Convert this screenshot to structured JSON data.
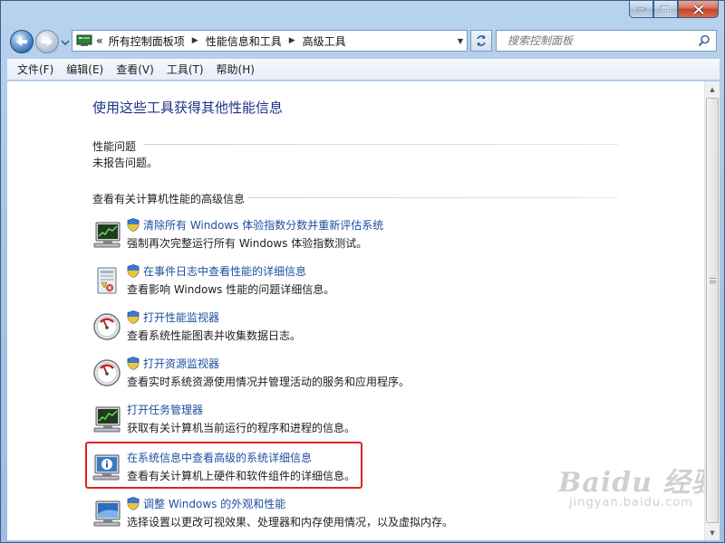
{
  "window": {
    "caption_buttons": [
      "minimize",
      "maximize",
      "close"
    ]
  },
  "address_bar": {
    "chevron": "«",
    "crumbs": [
      "所有控制面板项",
      "性能信息和工具",
      "高级工具"
    ]
  },
  "search": {
    "placeholder": "搜索控制面板"
  },
  "menu": [
    "文件(F)",
    "编辑(E)",
    "查看(V)",
    "工具(T)",
    "帮助(H)"
  ],
  "page": {
    "heading": "使用这些工具获得其他性能信息",
    "performance_issues_title": "性能问题",
    "performance_issues_text": "未报告问题。",
    "advanced_title": "查看有关计算机性能的高级信息"
  },
  "items": [
    {
      "link": "清除所有 Windows 体验指数分数并重新评估系统",
      "desc": "强制再次完整运行所有 Windows 体验指数测试。",
      "icon": "monitor-chart-icon",
      "shield": true
    },
    {
      "link": "在事件日志中查看性能的详细信息",
      "desc": "查看影响 Windows 性能的问题详细信息。",
      "icon": "event-log-icon",
      "shield": true
    },
    {
      "link": "打开性能监视器",
      "desc": "查看系统性能图表并收集数据日志。",
      "icon": "gauge-icon",
      "shield": true
    },
    {
      "link": "打开资源监视器",
      "desc": "查看实时系统资源使用情况并管理活动的服务和应用程序。",
      "icon": "gauge-icon",
      "shield": true
    },
    {
      "link": "打开任务管理器",
      "desc": "获取有关计算机当前运行的程序和进程的信息。",
      "icon": "monitor-chart-icon",
      "shield": false
    },
    {
      "link": "在系统信息中查看高级的系统详细信息",
      "desc": "查看有关计算机上硬件和软件组件的详细信息。",
      "icon": "system-info-icon",
      "shield": false,
      "highlighted": true
    },
    {
      "link": "调整 Windows 的外观和性能",
      "desc": "选择设置以更改可视效果、处理器和内存使用情况，以及虚拟内存。",
      "icon": "monitor-adjust-icon",
      "shield": true
    }
  ],
  "watermark": {
    "line1": "Baidu 经验",
    "line2": "jingyan.baidu.com"
  },
  "colors": {
    "link": "#1e4fa0",
    "heading": "#1e3287",
    "highlight": "#e02020"
  }
}
